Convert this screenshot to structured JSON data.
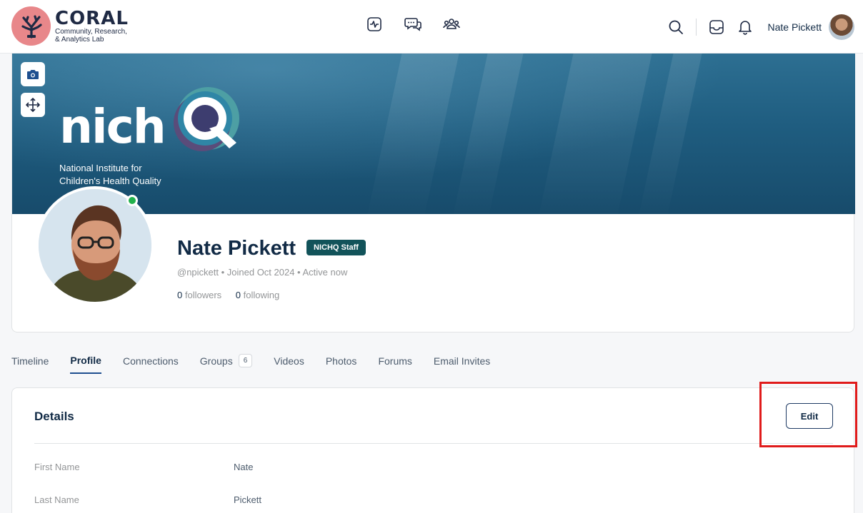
{
  "header": {
    "logo_word": "CORAL",
    "logo_sub_1": "Community, Research,",
    "logo_sub_2": "& Analytics Lab",
    "user_name": "Nate Pickett",
    "icons": [
      "activity-icon",
      "messages-icon",
      "members-icon",
      "search-icon",
      "inbox-icon",
      "bell-icon"
    ]
  },
  "cover": {
    "brand_word": "nich",
    "brand_sub_1": "National Institute for",
    "brand_sub_2": "Children's Health Quality"
  },
  "profile": {
    "name": "Nate Pickett",
    "badge": "NICHQ Staff",
    "meta": "@npickett • Joined Oct 2024 • Active now",
    "followers_count": "0",
    "followers_label": "followers",
    "following_count": "0",
    "following_label": "following"
  },
  "tabs": [
    {
      "label": "Timeline"
    },
    {
      "label": "Profile",
      "active": true
    },
    {
      "label": "Connections"
    },
    {
      "label": "Groups",
      "count": "6"
    },
    {
      "label": "Videos"
    },
    {
      "label": "Photos"
    },
    {
      "label": "Forums"
    },
    {
      "label": "Email Invites"
    }
  ],
  "details": {
    "title": "Details",
    "edit_label": "Edit",
    "fields": [
      {
        "label": "First Name",
        "value": "Nate"
      },
      {
        "label": "Last Name",
        "value": "Pickett"
      }
    ]
  },
  "colors": {
    "staff_badge": "#12535a",
    "highlight": "#e01b1b",
    "online": "#22b14c"
  }
}
